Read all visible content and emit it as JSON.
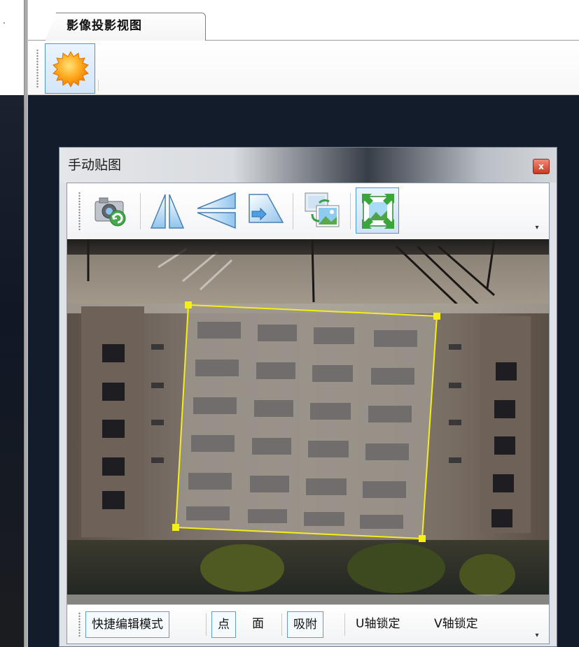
{
  "left_panel": {
    "chevron": "·"
  },
  "tab": {
    "label": "影像投影视图"
  },
  "toolbar": {
    "sun_icon": "sun-icon"
  },
  "window": {
    "title": "手动贴图",
    "close_glyph": "x",
    "tools": [
      {
        "name": "camera-sync-icon"
      },
      {
        "name": "mirror-horizontal-icon"
      },
      {
        "name": "mirror-vertical-icon"
      },
      {
        "name": "skew-icon"
      },
      {
        "name": "image-swap-icon"
      },
      {
        "name": "fit-expand-icon",
        "active": true
      }
    ],
    "overflow_glyph": "▾",
    "status_items": {
      "quick_edit": "快捷编辑模式",
      "point": "点",
      "face": "面",
      "snap": "吸附",
      "u_lock": "U轴锁定",
      "v_lock": "V轴锁定"
    },
    "selection_color": "#f5ee1a"
  }
}
